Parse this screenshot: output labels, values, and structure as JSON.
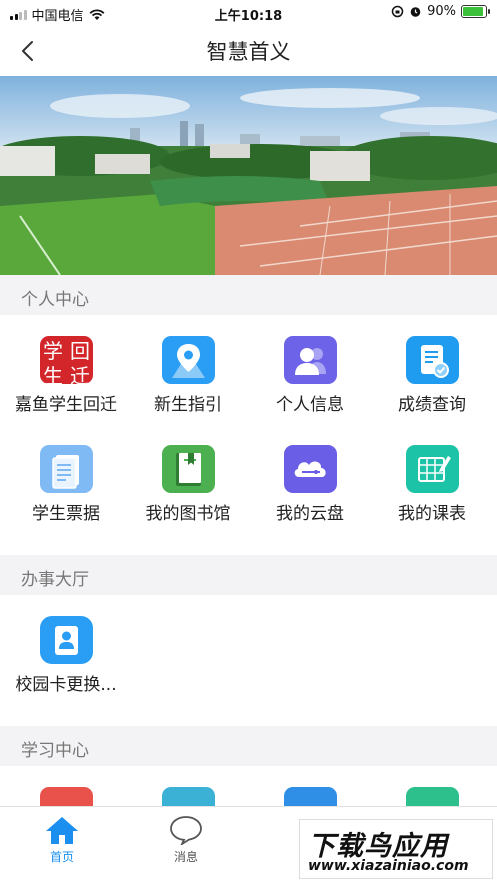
{
  "status_bar": {
    "carrier": "中国电信",
    "time": "上午10:18",
    "battery": "90%"
  },
  "nav": {
    "title": "智慧首义"
  },
  "sections": {
    "personal": {
      "title": "个人中心",
      "items": [
        {
          "label": "嘉鱼学生回迁",
          "icon": "student-return-stamp-icon"
        },
        {
          "label": "新生指引",
          "icon": "map-pin-icon"
        },
        {
          "label": "个人信息",
          "icon": "people-icon"
        },
        {
          "label": "成绩查询",
          "icon": "document-check-icon"
        },
        {
          "label": "学生票据",
          "icon": "receipt-icon"
        },
        {
          "label": "我的图书馆",
          "icon": "book-icon"
        },
        {
          "label": "我的云盘",
          "icon": "cloud-drive-icon"
        },
        {
          "label": "我的课表",
          "icon": "timetable-icon"
        }
      ]
    },
    "service_hall": {
      "title": "办事大厅",
      "items": [
        {
          "label": "校园卡更换...",
          "icon": "id-card-icon"
        }
      ]
    },
    "study": {
      "title": "学习中心"
    }
  },
  "stamp_text": [
    "学",
    "回",
    "生",
    "迁"
  ],
  "tabbar": {
    "items": [
      {
        "label": "首页",
        "icon": "home-icon",
        "active": true
      },
      {
        "label": "消息",
        "icon": "message-icon",
        "active": false
      }
    ]
  },
  "watermark": {
    "title": "下载鸟应用",
    "url": "www.xiazainiao.com"
  },
  "colors": {
    "accent": "#1a8ff0",
    "tile_blue": "#2a9df4",
    "tile_green": "#4caf50",
    "tile_purple": "#7065e8",
    "tile_teal": "#1cc3a6",
    "stamp_red": "#d3262b"
  }
}
